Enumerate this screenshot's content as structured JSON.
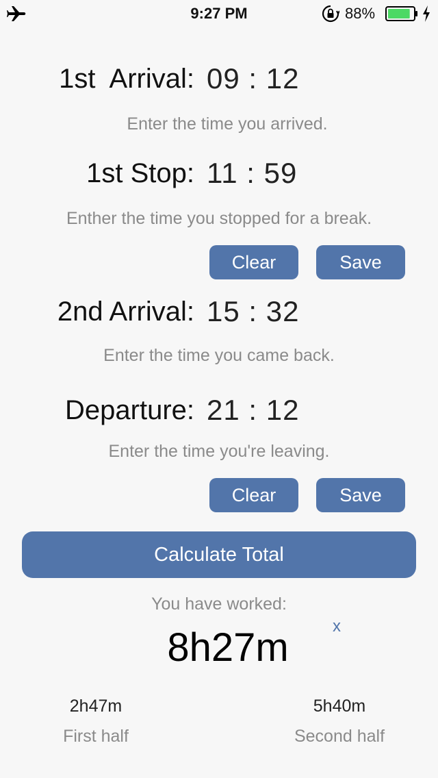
{
  "status_bar": {
    "time": "9:27 PM",
    "battery_percent": "88%",
    "icons": [
      "airplane-icon",
      "rotation-lock-icon",
      "battery-icon",
      "charging-bolt-icon"
    ],
    "battery_level": 0.88,
    "battery_color": "#4cd964"
  },
  "rows": {
    "first_arrival": {
      "label": "1st  Arrival:",
      "value": "09 : 12",
      "hint": "Enter the time you arrived."
    },
    "first_stop": {
      "label": "1st Stop:",
      "value": "11 : 59",
      "hint": "Enther the time you stopped for a break."
    },
    "second_arrival": {
      "label": "2nd Arrival:",
      "value": "15 : 32",
      "hint": "Enter the time you came back."
    },
    "departure": {
      "label": "Departure:",
      "value": "21 : 12",
      "hint": "Enter the time you're leaving."
    }
  },
  "buttons": {
    "clear_label": "Clear",
    "save_label": "Save",
    "calculate_label": "Calculate Total"
  },
  "result": {
    "worked_label": "You have worked:",
    "reset_label": "x",
    "total": "8h27m",
    "first_half_value": "2h47m",
    "first_half_label": "First half",
    "second_half_value": "5h40m",
    "second_half_label": "Second half"
  },
  "colors": {
    "accent": "#5275aa",
    "background": "#f7f7f7",
    "hint_text": "#8a8a8a"
  }
}
